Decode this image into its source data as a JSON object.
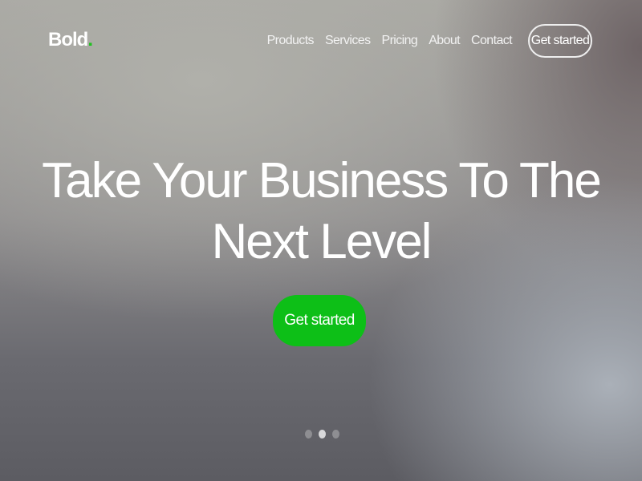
{
  "brand": {
    "name": "Bold",
    "dot": "."
  },
  "nav": {
    "items": [
      "Products",
      "Services",
      "Pricing",
      "About",
      "Contact"
    ],
    "cta": "Get started"
  },
  "hero": {
    "line1": "Take Your Business To The",
    "line2": "Next Level",
    "cta": "Get started",
    "accent": "#0dbf17"
  },
  "carousel": {
    "count": 3,
    "active": 2
  }
}
